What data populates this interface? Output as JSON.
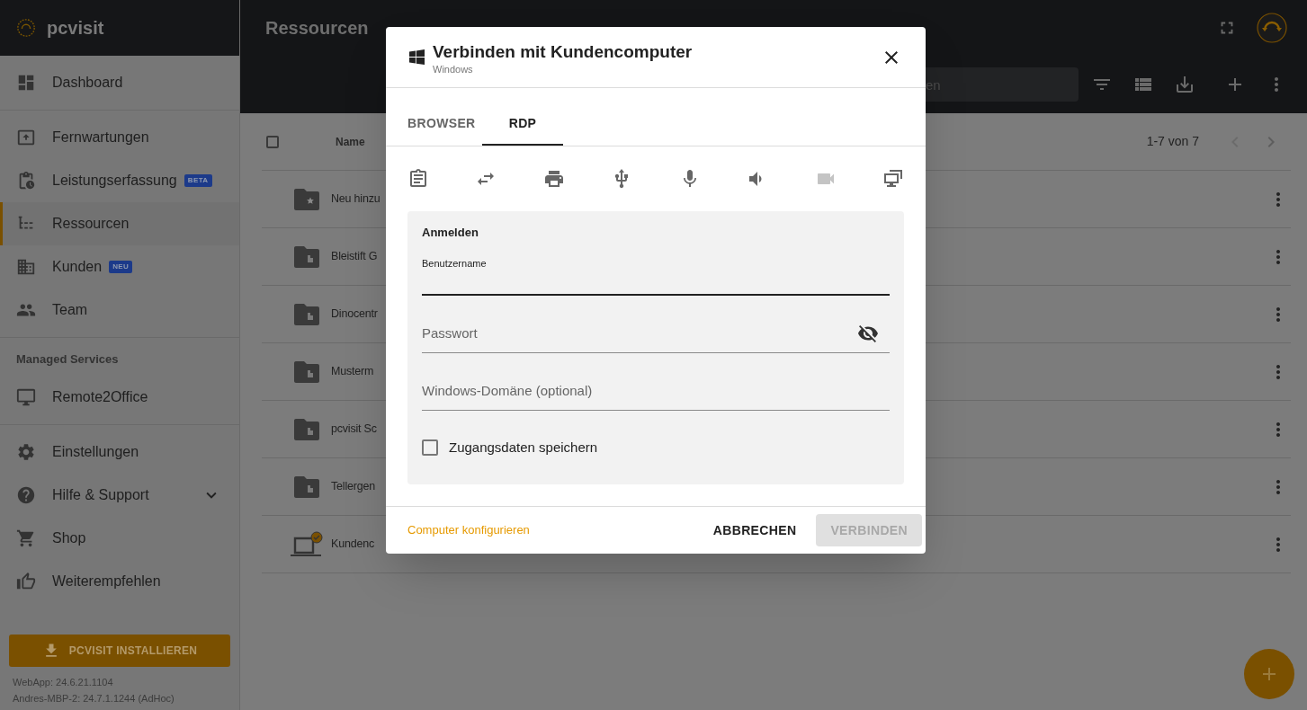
{
  "app": {
    "logo_text": "pcvisit"
  },
  "sidebar": {
    "groups": [
      {
        "items": [
          {
            "label": "Dashboard",
            "selected": false
          }
        ]
      },
      {
        "items": [
          {
            "label": "Fernwartungen",
            "selected": false
          },
          {
            "label": "Leistungserfassung",
            "badge": "BETA",
            "selected": false
          },
          {
            "label": "Ressourcen",
            "selected": true
          },
          {
            "label": "Kunden",
            "badge": "NEU",
            "selected": false
          },
          {
            "label": "Team",
            "selected": false
          }
        ]
      },
      {
        "heading": "Managed Services",
        "items": [
          {
            "label": "Remote2Office",
            "selected": false
          }
        ]
      },
      {
        "items": [
          {
            "label": "Einstellungen",
            "selected": false
          },
          {
            "label": "Hilfe & Support",
            "selected": false,
            "expanded": false
          },
          {
            "label": "Shop",
            "selected": false
          },
          {
            "label": "Weiterempfehlen",
            "selected": false
          }
        ]
      }
    ],
    "install_button": "PCVISIT INSTALLIEREN",
    "versions": [
      "WebApp: 24.6.21.1104",
      "Andres-MBP-2: 24.7.1.1244 (AdHoc)"
    ]
  },
  "header": {
    "title": "Ressourcen",
    "search": {
      "placeholder": "en"
    }
  },
  "table": {
    "columns": [
      "Name"
    ],
    "pagination": "1-7 von 7",
    "select_all": false,
    "rows": [
      {
        "kind": "favorites",
        "name": "Neu hinzu"
      },
      {
        "kind": "customer",
        "name": "Bleistift G"
      },
      {
        "kind": "customer",
        "name": "Dinocentr"
      },
      {
        "kind": "customer",
        "name": "Musterm"
      },
      {
        "kind": "customer",
        "name": "pcvisit Sc"
      },
      {
        "kind": "customer",
        "name": "Tellergen"
      },
      {
        "kind": "computer",
        "name": "Kundenc"
      }
    ]
  },
  "dialog": {
    "title": "Verbinden mit Kundencomputer",
    "subtitle": "Windows",
    "tabs": [
      {
        "label": "BROWSER",
        "selected": false
      },
      {
        "label": "RDP",
        "selected": true
      }
    ],
    "features": [
      {
        "disabled": false
      },
      {
        "disabled": false
      },
      {
        "disabled": false
      },
      {
        "disabled": false
      },
      {
        "disabled": false
      },
      {
        "disabled": false
      },
      {
        "disabled": true
      },
      {
        "disabled": false
      }
    ],
    "section_title": "Anmelden",
    "fields": [
      {
        "kind": "text",
        "label": "Benutzername",
        "focused": true
      },
      {
        "kind": "password",
        "placeholder": "Passwort",
        "password_visible": false
      },
      {
        "kind": "text",
        "placeholder": "Windows-Domäne (optional)",
        "focused": false
      }
    ],
    "remember": {
      "label": "Zugangsdaten speichern",
      "checked": false
    },
    "link": "Computer konfigurieren",
    "buttons": [
      {
        "kind": "cancel",
        "label": "ABBRECHEN",
        "disabled": false
      },
      {
        "kind": "primary",
        "label": "VERBINDEN",
        "disabled": true
      }
    ]
  }
}
